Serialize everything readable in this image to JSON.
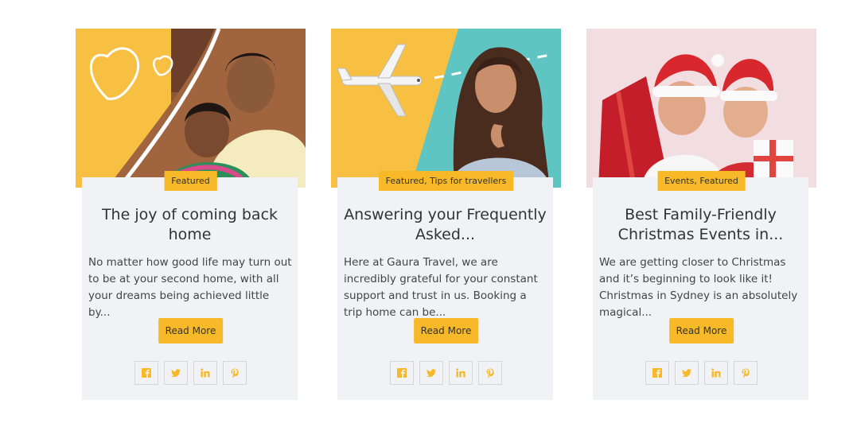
{
  "cards": [
    {
      "badge": "Featured",
      "title": "The joy of coming back home",
      "excerpt": "No matter how good life may turn out to be at your second home, with all your dreams being achieved little by...",
      "button": "Read More"
    },
    {
      "badge": "Featured, Tips for travellers",
      "title": "Answering your Frequently Asked...",
      "excerpt": "Here at Gaura Travel, we are incredibly grateful for your constant support and trust in us. Booking a trip home can be...",
      "button": "Read More"
    },
    {
      "badge": "Events, Featured",
      "title": "Best Family-Friendly Christmas Events in...",
      "excerpt": "We are getting closer to Christmas and it’s beginning to look like it! Christmas in Sydney is an absolutely magical...",
      "button": "Read More"
    }
  ],
  "social_icons": [
    "facebook-icon",
    "twitter-icon",
    "linkedin-icon",
    "pinterest-icon"
  ],
  "colors": {
    "accent": "#f7b928",
    "panel": "#f1f2f5",
    "teal": "#5ec5c2"
  }
}
